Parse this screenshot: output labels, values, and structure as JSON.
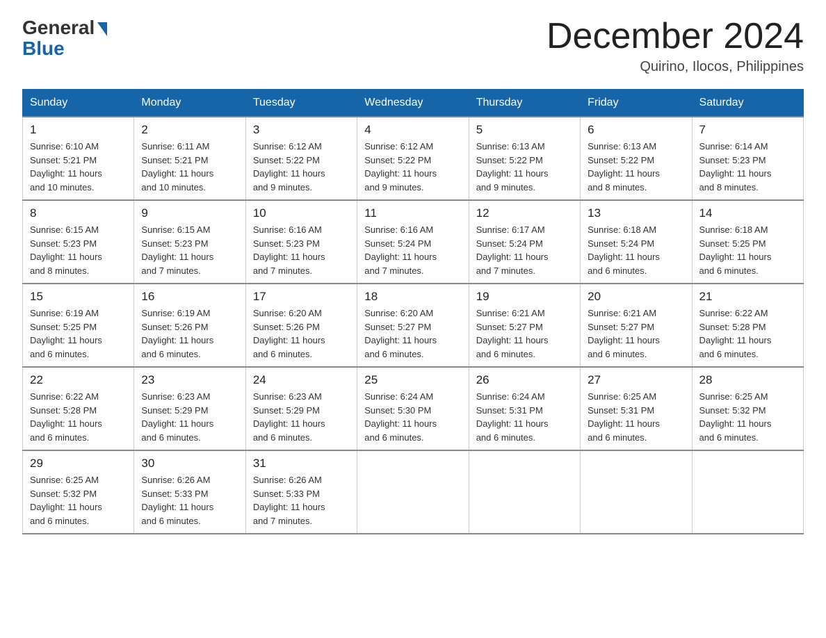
{
  "logo": {
    "general": "General",
    "blue": "Blue"
  },
  "header": {
    "month": "December 2024",
    "location": "Quirino, Ilocos, Philippines"
  },
  "weekdays": [
    "Sunday",
    "Monday",
    "Tuesday",
    "Wednesday",
    "Thursday",
    "Friday",
    "Saturday"
  ],
  "weeks": [
    [
      {
        "day": "1",
        "sunrise": "6:10 AM",
        "sunset": "5:21 PM",
        "daylight": "11 hours and 10 minutes."
      },
      {
        "day": "2",
        "sunrise": "6:11 AM",
        "sunset": "5:21 PM",
        "daylight": "11 hours and 10 minutes."
      },
      {
        "day": "3",
        "sunrise": "6:12 AM",
        "sunset": "5:22 PM",
        "daylight": "11 hours and 9 minutes."
      },
      {
        "day": "4",
        "sunrise": "6:12 AM",
        "sunset": "5:22 PM",
        "daylight": "11 hours and 9 minutes."
      },
      {
        "day": "5",
        "sunrise": "6:13 AM",
        "sunset": "5:22 PM",
        "daylight": "11 hours and 9 minutes."
      },
      {
        "day": "6",
        "sunrise": "6:13 AM",
        "sunset": "5:22 PM",
        "daylight": "11 hours and 8 minutes."
      },
      {
        "day": "7",
        "sunrise": "6:14 AM",
        "sunset": "5:23 PM",
        "daylight": "11 hours and 8 minutes."
      }
    ],
    [
      {
        "day": "8",
        "sunrise": "6:15 AM",
        "sunset": "5:23 PM",
        "daylight": "11 hours and 8 minutes."
      },
      {
        "day": "9",
        "sunrise": "6:15 AM",
        "sunset": "5:23 PM",
        "daylight": "11 hours and 7 minutes."
      },
      {
        "day": "10",
        "sunrise": "6:16 AM",
        "sunset": "5:23 PM",
        "daylight": "11 hours and 7 minutes."
      },
      {
        "day": "11",
        "sunrise": "6:16 AM",
        "sunset": "5:24 PM",
        "daylight": "11 hours and 7 minutes."
      },
      {
        "day": "12",
        "sunrise": "6:17 AM",
        "sunset": "5:24 PM",
        "daylight": "11 hours and 7 minutes."
      },
      {
        "day": "13",
        "sunrise": "6:18 AM",
        "sunset": "5:24 PM",
        "daylight": "11 hours and 6 minutes."
      },
      {
        "day": "14",
        "sunrise": "6:18 AM",
        "sunset": "5:25 PM",
        "daylight": "11 hours and 6 minutes."
      }
    ],
    [
      {
        "day": "15",
        "sunrise": "6:19 AM",
        "sunset": "5:25 PM",
        "daylight": "11 hours and 6 minutes."
      },
      {
        "day": "16",
        "sunrise": "6:19 AM",
        "sunset": "5:26 PM",
        "daylight": "11 hours and 6 minutes."
      },
      {
        "day": "17",
        "sunrise": "6:20 AM",
        "sunset": "5:26 PM",
        "daylight": "11 hours and 6 minutes."
      },
      {
        "day": "18",
        "sunrise": "6:20 AM",
        "sunset": "5:27 PM",
        "daylight": "11 hours and 6 minutes."
      },
      {
        "day": "19",
        "sunrise": "6:21 AM",
        "sunset": "5:27 PM",
        "daylight": "11 hours and 6 minutes."
      },
      {
        "day": "20",
        "sunrise": "6:21 AM",
        "sunset": "5:27 PM",
        "daylight": "11 hours and 6 minutes."
      },
      {
        "day": "21",
        "sunrise": "6:22 AM",
        "sunset": "5:28 PM",
        "daylight": "11 hours and 6 minutes."
      }
    ],
    [
      {
        "day": "22",
        "sunrise": "6:22 AM",
        "sunset": "5:28 PM",
        "daylight": "11 hours and 6 minutes."
      },
      {
        "day": "23",
        "sunrise": "6:23 AM",
        "sunset": "5:29 PM",
        "daylight": "11 hours and 6 minutes."
      },
      {
        "day": "24",
        "sunrise": "6:23 AM",
        "sunset": "5:29 PM",
        "daylight": "11 hours and 6 minutes."
      },
      {
        "day": "25",
        "sunrise": "6:24 AM",
        "sunset": "5:30 PM",
        "daylight": "11 hours and 6 minutes."
      },
      {
        "day": "26",
        "sunrise": "6:24 AM",
        "sunset": "5:31 PM",
        "daylight": "11 hours and 6 minutes."
      },
      {
        "day": "27",
        "sunrise": "6:25 AM",
        "sunset": "5:31 PM",
        "daylight": "11 hours and 6 minutes."
      },
      {
        "day": "28",
        "sunrise": "6:25 AM",
        "sunset": "5:32 PM",
        "daylight": "11 hours and 6 minutes."
      }
    ],
    [
      {
        "day": "29",
        "sunrise": "6:25 AM",
        "sunset": "5:32 PM",
        "daylight": "11 hours and 6 minutes."
      },
      {
        "day": "30",
        "sunrise": "6:26 AM",
        "sunset": "5:33 PM",
        "daylight": "11 hours and 6 minutes."
      },
      {
        "day": "31",
        "sunrise": "6:26 AM",
        "sunset": "5:33 PM",
        "daylight": "11 hours and 7 minutes."
      },
      null,
      null,
      null,
      null
    ]
  ],
  "labels": {
    "sunrise": "Sunrise:",
    "sunset": "Sunset:",
    "daylight": "Daylight:"
  }
}
